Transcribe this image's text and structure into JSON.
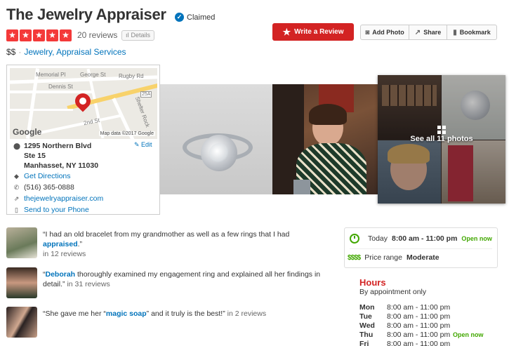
{
  "business": {
    "name": "The Jewelry Appraiser",
    "claimed_label": "Claimed",
    "review_count": "20 reviews",
    "details_label": "Details",
    "price": "$$",
    "separator": "·",
    "category_1": "Jewelry,",
    "category_2": "Appraisal Services",
    "rating_stars": 5
  },
  "actions": {
    "write_review": "Write a Review",
    "add_photo": "Add Photo",
    "share": "Share",
    "bookmark": "Bookmark"
  },
  "map": {
    "labels": {
      "memorial": "Memorial Pl",
      "george": "George St",
      "rugby": "Rugby Rd",
      "dennis": "Dennis St",
      "route": "25A",
      "shelter": "Shelter Rock",
      "second": "2nd St"
    },
    "logo": "Google",
    "attribution": "Map data ©2017 Google"
  },
  "address": {
    "line1": "1295 Northern Blvd",
    "line2": "Ste 15",
    "line3": "Manhasset, NY 11030",
    "edit": "Edit",
    "directions": "Get Directions",
    "phone": "(516) 365-0888",
    "website": "thejewelryappraiser.com",
    "send": "Send to your Phone"
  },
  "photos": {
    "see_all": "See all 11 photos"
  },
  "reviews": [
    {
      "pre": "“I had an old bracelet from my grandmother as well as a few rings that I had ",
      "keyword": "appraised",
      "post": ".”",
      "count": "in 12 reviews"
    },
    {
      "pre": "“",
      "keyword": "Deborah",
      "post": " thoroughly examined my engagement ring and explained all her findings in detail.”",
      "count": "in 31 reviews"
    },
    {
      "pre": "“She gave me her “",
      "keyword": "magic soap",
      "post": "” and it truly is the best!”",
      "count": "in 2 reviews"
    }
  ],
  "info": {
    "today_label": "Today",
    "today_hours": "8:00 am - 11:00 pm",
    "open_now": "Open now",
    "price_icon": "$$$$",
    "price_range_label": "Price range",
    "price_range_value": "Moderate"
  },
  "hours": {
    "title": "Hours",
    "subtitle": "By appointment only",
    "days": [
      {
        "day": "Mon",
        "time": "8:00 am - 11:00 pm",
        "status": ""
      },
      {
        "day": "Tue",
        "time": "8:00 am - 11:00 pm",
        "status": ""
      },
      {
        "day": "Wed",
        "time": "8:00 am - 11:00 pm",
        "status": ""
      },
      {
        "day": "Thu",
        "time": "8:00 am - 11:00 pm",
        "status": "Open now"
      },
      {
        "day": "Fri",
        "time": "8:00 am - 11:00 pm",
        "status": ""
      }
    ]
  },
  "colors": {
    "brand_red": "#d32323",
    "link_blue": "#0073bb",
    "open_green": "#41a700",
    "star_red": "#f43939"
  },
  "icons": {
    "claimed": "check-circle-icon",
    "star": "star-icon",
    "details": "bar-chart-icon",
    "write_review": "star-icon",
    "add_photo": "camera-icon",
    "share": "share-icon",
    "bookmark": "bookmark-icon",
    "pin": "map-pin-icon",
    "edit": "pencil-icon",
    "directions": "directions-icon",
    "phone": "phone-icon",
    "website": "external-link-icon",
    "send": "mobile-phone-icon",
    "today": "clock-icon",
    "price": "dollar-icon",
    "photos": "grid-icon"
  }
}
